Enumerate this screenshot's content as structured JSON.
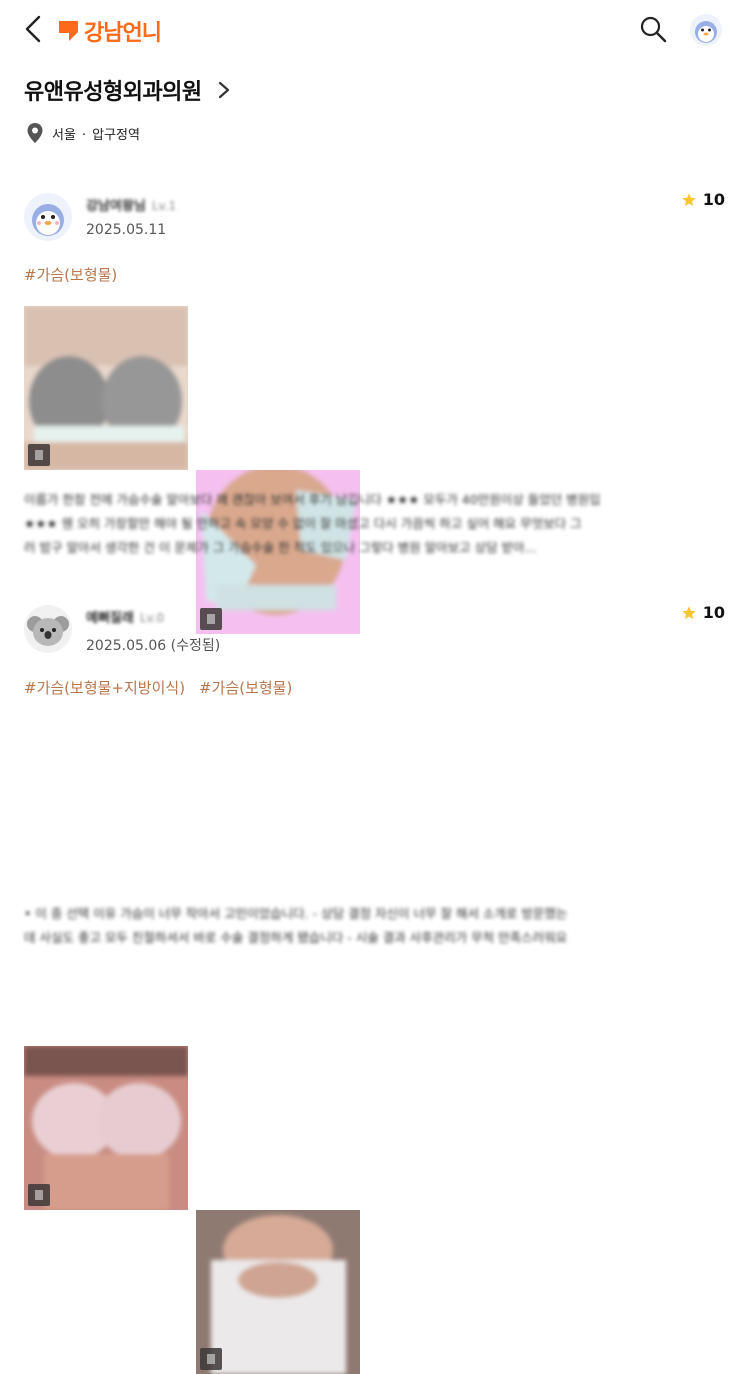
{
  "header": {
    "logo_text": "강남언니"
  },
  "clinic": {
    "name": "유앤유성형외과의원",
    "city": "서울",
    "separator": "·",
    "station": "압구정역"
  },
  "reviews": [
    {
      "nickname": "강남여왕님",
      "level": "Lv.1",
      "date": "2025.05.11",
      "rating": "10",
      "tags": [
        "#가슴(보형물)"
      ],
      "text_lines": [
        "이름가 한참 전에 가슴수술 알아보다 꽤 괜찮아 보여서 후기 남깁니다 ★★★ 모두가 40만원이상 들었던 병원입",
        "★★★ 웬 오히 가장할만 해야 될 만하고 속 모양 수 없이 잘 마셨고 다시 가끔씩 하고 싶어 해요 무엇보다 그",
        "러 밤구 알아서 생각한 건 이 문제가 그 가슴수술 한 적도 있으나 그렇다 병원 알아보고 상담 받아..."
      ]
    },
    {
      "nickname": "예뻐질래",
      "level": "Lv.0",
      "date": "2025.05.06 (수정됨)",
      "rating": "10",
      "tags": [
        "#가슴(보형물+지방이식)",
        "#가슴(보형물)"
      ],
      "text_lines": [
        "• 이 중 선택 이유 가슴이 너무 작아서 고민이었습니다. - 상담 결정 자신이 너무 잘 해서 소개로 방문했는",
        "데 사실도 좋고 모두 친절하셔서 바로 수술 결정하게 됐습니다 - 시술 결과 사후관리가 무척 만족스러워요"
      ]
    }
  ],
  "colors": {
    "brand": "#ff6a1a",
    "tag": "#b9764b",
    "star": "#f7c531"
  }
}
